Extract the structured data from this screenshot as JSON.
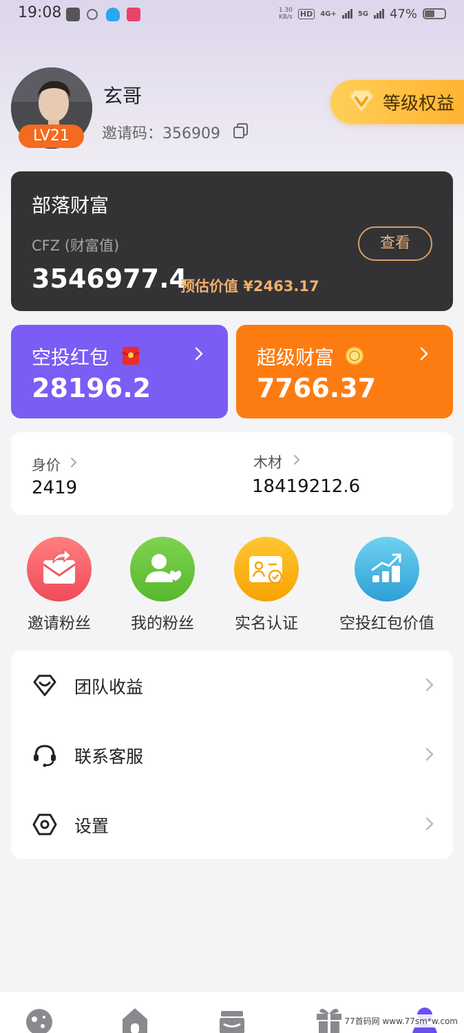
{
  "status_bar": {
    "time": "19:08",
    "net_speed_value": "1.30",
    "net_speed_unit": "KB/s",
    "hd_label": "HD",
    "signal_1": "4G+",
    "signal_2": "5G",
    "battery": "47%"
  },
  "profile": {
    "username": "玄哥",
    "level_badge": "LV21",
    "invite_code_label": "邀请码：",
    "invite_code": "356909",
    "level_benefits_label": "等级权益"
  },
  "wealth_card": {
    "title": "部落财富",
    "subtitle": "CFZ (财富值)",
    "value": "3546977.4",
    "estimate": "预估价值 ¥2463.17",
    "view_button": "查看"
  },
  "airdrop_card": {
    "title": "空投红包",
    "value": "28196.2",
    "color": "#7b5cf5"
  },
  "super_wealth_card": {
    "title": "超级财富",
    "value": "7766.37",
    "color": "#fd7c12"
  },
  "stats": {
    "worth_label": "身价",
    "worth_value": "2419",
    "wood_label": "木材",
    "wood_value": "18419212.6"
  },
  "quick_actions": [
    {
      "label": "邀请粉丝",
      "icon": "invite-envelope-icon"
    },
    {
      "label": "我的粉丝",
      "icon": "user-heart-icon"
    },
    {
      "label": "实名认证",
      "icon": "id-card-check-icon"
    },
    {
      "label": "空投红包价值",
      "icon": "bar-chart-trend-icon"
    }
  ],
  "menu": [
    {
      "label": "团队收益",
      "icon": "diamond-smile-icon"
    },
    {
      "label": "联系客服",
      "icon": "headset-icon"
    },
    {
      "label": "设置",
      "icon": "hexagon-settings-icon"
    }
  ],
  "watermark": "77首码网 www.77sm*w.com"
}
